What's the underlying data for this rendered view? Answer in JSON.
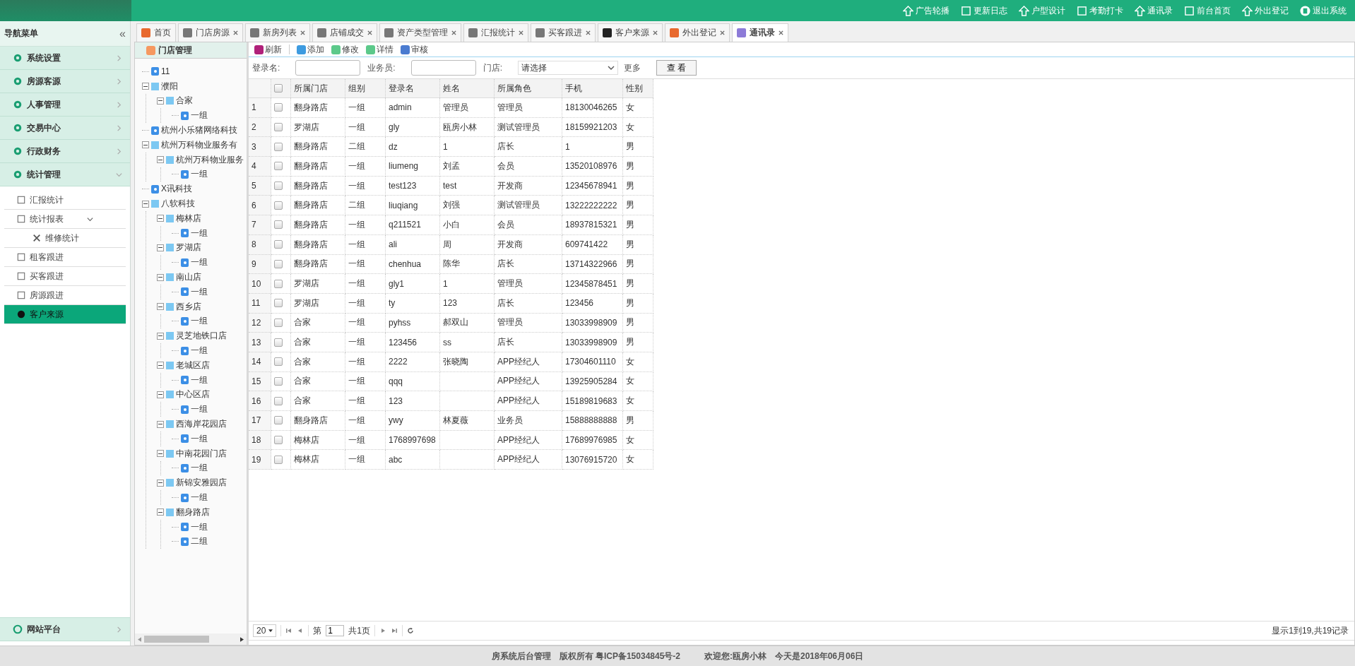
{
  "top_links": [
    "广告轮播",
    "更新日志",
    "户型设计",
    "考勤打卡",
    "通讯录",
    "前台首页",
    "外出登记",
    "退出系统"
  ],
  "sidebar": {
    "title": "导航菜单",
    "collapse": "«",
    "menu": [
      {
        "label": "系统设置",
        "expanded": false
      },
      {
        "label": "房源客源",
        "expanded": false
      },
      {
        "label": "人事管理",
        "expanded": false
      },
      {
        "label": "交易中心",
        "expanded": false
      },
      {
        "label": "行政财务",
        "expanded": false
      },
      {
        "label": "统计管理",
        "expanded": true,
        "children": [
          {
            "label": "汇报统计",
            "selected": false
          },
          {
            "label": "统计报表",
            "selected": false,
            "expanded": true,
            "children": [
              {
                "label": "维修统计",
                "selected": false
              }
            ]
          },
          {
            "label": "租客跟进",
            "selected": false
          },
          {
            "label": "买客跟进",
            "selected": false
          },
          {
            "label": "房源跟进",
            "selected": false
          },
          {
            "label": "客户来源",
            "selected": true
          }
        ]
      }
    ],
    "bottom": {
      "label": "网站平台",
      "expanded": false
    }
  },
  "tabs": [
    {
      "label": "首页",
      "closable": false,
      "selected": false
    },
    {
      "label": "门店房源",
      "closable": true,
      "selected": false
    },
    {
      "label": "新房列表",
      "closable": true,
      "selected": false
    },
    {
      "label": "店铺成交",
      "closable": true,
      "selected": false
    },
    {
      "label": "资产类型管理",
      "closable": true,
      "selected": false
    },
    {
      "label": "汇报统计",
      "closable": true,
      "selected": false
    },
    {
      "label": "买客跟进",
      "closable": true,
      "selected": false
    },
    {
      "label": "客户来源",
      "closable": true,
      "selected": false
    },
    {
      "label": "外出登记",
      "closable": true,
      "selected": false
    },
    {
      "label": "通讯录",
      "closable": true,
      "selected": true
    }
  ],
  "tree": {
    "title": "门店管理",
    "nodes": [
      {
        "label": "11"
      },
      {
        "label": "濮阳",
        "expanded": true,
        "children": [
          {
            "label": "合家",
            "expanded": true,
            "children": [
              {
                "label": "一组"
              }
            ]
          }
        ]
      },
      {
        "label": "杭州小乐猪网络科技"
      },
      {
        "label": "杭州万科物业服务有",
        "expanded": true,
        "children": [
          {
            "label": "杭州万科物业服务",
            "expanded": true,
            "children": [
              {
                "label": "一组"
              }
            ]
          }
        ]
      },
      {
        "label": "X讯科技"
      },
      {
        "label": "八软科技",
        "expanded": true,
        "children": [
          {
            "label": "梅林店",
            "expanded": true,
            "children": [
              {
                "label": "一组"
              }
            ]
          },
          {
            "label": "罗湖店",
            "expanded": true,
            "children": [
              {
                "label": "一组"
              }
            ]
          },
          {
            "label": "南山店",
            "expanded": true,
            "children": [
              {
                "label": "一组"
              }
            ]
          },
          {
            "label": "西乡店",
            "expanded": true,
            "children": [
              {
                "label": "一组"
              }
            ]
          },
          {
            "label": "灵芝地铁口店",
            "expanded": true,
            "children": [
              {
                "label": "一组"
              }
            ]
          },
          {
            "label": "老城区店",
            "expanded": true,
            "children": [
              {
                "label": "一组"
              }
            ]
          },
          {
            "label": "中心区店",
            "expanded": true,
            "children": [
              {
                "label": "一组"
              }
            ]
          },
          {
            "label": "西海岸花园店",
            "expanded": true,
            "children": [
              {
                "label": "一组"
              }
            ]
          },
          {
            "label": "中南花园门店",
            "expanded": true,
            "children": [
              {
                "label": "一组"
              }
            ]
          },
          {
            "label": "新锦安雅园店",
            "expanded": true,
            "children": [
              {
                "label": "一组"
              }
            ]
          },
          {
            "label": "翻身路店",
            "expanded": true,
            "children": [
              {
                "label": "一组"
              },
              {
                "label": "二组"
              }
            ]
          }
        ]
      }
    ]
  },
  "toolbar": [
    "刷新",
    "添加",
    "修改",
    "详情",
    "审核"
  ],
  "search": {
    "fields": [
      {
        "label": "登录名:"
      },
      {
        "label": "业务员:"
      }
    ],
    "store_label": "门店:",
    "store_select": "请选择",
    "more": "更多",
    "button": "查 看"
  },
  "table": {
    "header_checked": false,
    "columns": [
      "所属门店",
      "组别",
      "登录名",
      "姓名",
      "所属角色",
      "手机",
      "性别"
    ],
    "rows": [
      {
        "num": "1",
        "checked": false,
        "cells": [
          "翻身路店",
          "一组",
          "admin",
          "管理员",
          "管理员",
          "18130046265",
          "女"
        ]
      },
      {
        "num": "2",
        "checked": false,
        "cells": [
          "罗湖店",
          "一组",
          "gly",
          "瓯房小林",
          "测试管理员",
          "18159921203",
          "女"
        ]
      },
      {
        "num": "3",
        "checked": false,
        "cells": [
          "翻身路店",
          "二组",
          "dz",
          "1",
          "店长",
          "1",
          "男"
        ]
      },
      {
        "num": "4",
        "checked": false,
        "cells": [
          "翻身路店",
          "一组",
          "liumeng",
          "刘孟",
          "会员",
          "13520108976",
          "男"
        ]
      },
      {
        "num": "5",
        "checked": false,
        "cells": [
          "翻身路店",
          "一组",
          "test123",
          "test",
          "开发商",
          "12345678941",
          "男"
        ]
      },
      {
        "num": "6",
        "checked": false,
        "cells": [
          "翻身路店",
          "二组",
          "liuqiang",
          "刘强",
          "测试管理员",
          "13222222222",
          "男"
        ]
      },
      {
        "num": "7",
        "checked": false,
        "cells": [
          "翻身路店",
          "一组",
          "q211521",
          "小白",
          "会员",
          "18937815321",
          "男"
        ]
      },
      {
        "num": "8",
        "checked": false,
        "cells": [
          "翻身路店",
          "一组",
          "ali",
          "周",
          "开发商",
          "609741422",
          "男"
        ]
      },
      {
        "num": "9",
        "checked": false,
        "cells": [
          "翻身路店",
          "一组",
          "chenhua",
          "陈华",
          "店长",
          "13714322966",
          "男"
        ]
      },
      {
        "num": "10",
        "checked": false,
        "cells": [
          "罗湖店",
          "一组",
          "gly1",
          "1",
          "管理员",
          "12345878451",
          "男"
        ]
      },
      {
        "num": "11",
        "checked": false,
        "cells": [
          "罗湖店",
          "一组",
          "ty",
          "123",
          "店长",
          "123456",
          "男"
        ]
      },
      {
        "num": "12",
        "checked": false,
        "cells": [
          "合家",
          "一组",
          "pyhss",
          "郝双山",
          "管理员",
          "13033998909",
          "男"
        ]
      },
      {
        "num": "13",
        "checked": false,
        "cells": [
          "合家",
          "一组",
          "123456",
          "ss",
          "店长",
          "13033998909",
          "男"
        ]
      },
      {
        "num": "14",
        "checked": false,
        "cells": [
          "合家",
          "一组",
          "2222",
          "张晓陶",
          "APP经纪人",
          "17304601110",
          "女"
        ]
      },
      {
        "num": "15",
        "checked": false,
        "cells": [
          "合家",
          "一组",
          "qqq",
          "",
          "APP经纪人",
          "13925905284",
          "女"
        ]
      },
      {
        "num": "16",
        "checked": false,
        "cells": [
          "合家",
          "一组",
          "123",
          "",
          "APP经纪人",
          "15189819683",
          "女"
        ]
      },
      {
        "num": "17",
        "checked": false,
        "cells": [
          "翻身路店",
          "一组",
          "ywy",
          "林夏薇",
          "业务员",
          "15888888888",
          "男"
        ]
      },
      {
        "num": "18",
        "checked": false,
        "cells": [
          "梅林店",
          "一组",
          "1768997698",
          "",
          "APP经纪人",
          "17689976985",
          "女"
        ]
      },
      {
        "num": "19",
        "checked": false,
        "cells": [
          "梅林店",
          "一组",
          "abc",
          "",
          "APP经纪人",
          "13076915720",
          "女"
        ]
      }
    ]
  },
  "pager": {
    "page_size": "20",
    "page_prefix": "第",
    "page": "1",
    "page_total": "共1页",
    "summary": "显示1到19,共19记录"
  },
  "footer": [
    "房系统后台管理",
    "版权所有 粤ICP备15034845号-2",
    "欢迎您:瓯房小林",
    "今天是2018年06月06日"
  ]
}
